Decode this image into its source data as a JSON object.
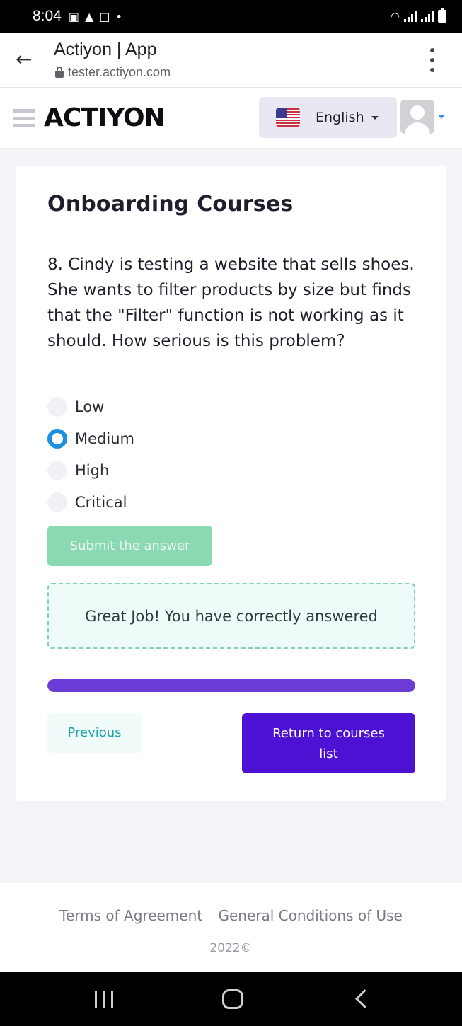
{
  "status_bar": {
    "time": "8:04",
    "icons": [
      "shopping-bag-icon",
      "notification-icon",
      "video-icon",
      "dot-icon",
      "wifi-icon",
      "signal-icon",
      "battery-icon"
    ]
  },
  "browser": {
    "title": "Actiyon | App",
    "url": "tester.actiyon.com"
  },
  "header": {
    "logo": "ACTIYON",
    "language": "English"
  },
  "course": {
    "title": "Onboarding Courses",
    "question": "8. Cindy is testing a website that sells shoes. She wants to filter products by size but finds that the \"Filter\" function is not working as it should. How serious is this problem?",
    "options": [
      {
        "label": "Low",
        "selected": false
      },
      {
        "label": "Medium",
        "selected": true
      },
      {
        "label": "High",
        "selected": false
      },
      {
        "label": "Critical",
        "selected": false
      }
    ],
    "submit_label": "Submit the answer",
    "feedback": "Great Job! You have correctly answered",
    "progress_fraction": 1.0,
    "previous_label": "Previous",
    "return_label": "Return to courses list"
  },
  "footer": {
    "links": [
      "Terms of Agreement",
      "General Conditions of Use"
    ],
    "copyright": "2022©"
  },
  "colors": {
    "accent_purple": "#4d11d4",
    "progress_purple": "#6c3bd6",
    "radio_blue": "#1b8fe0",
    "submit_green": "#8ad9b2",
    "previous_teal": "#1aa3a8"
  }
}
